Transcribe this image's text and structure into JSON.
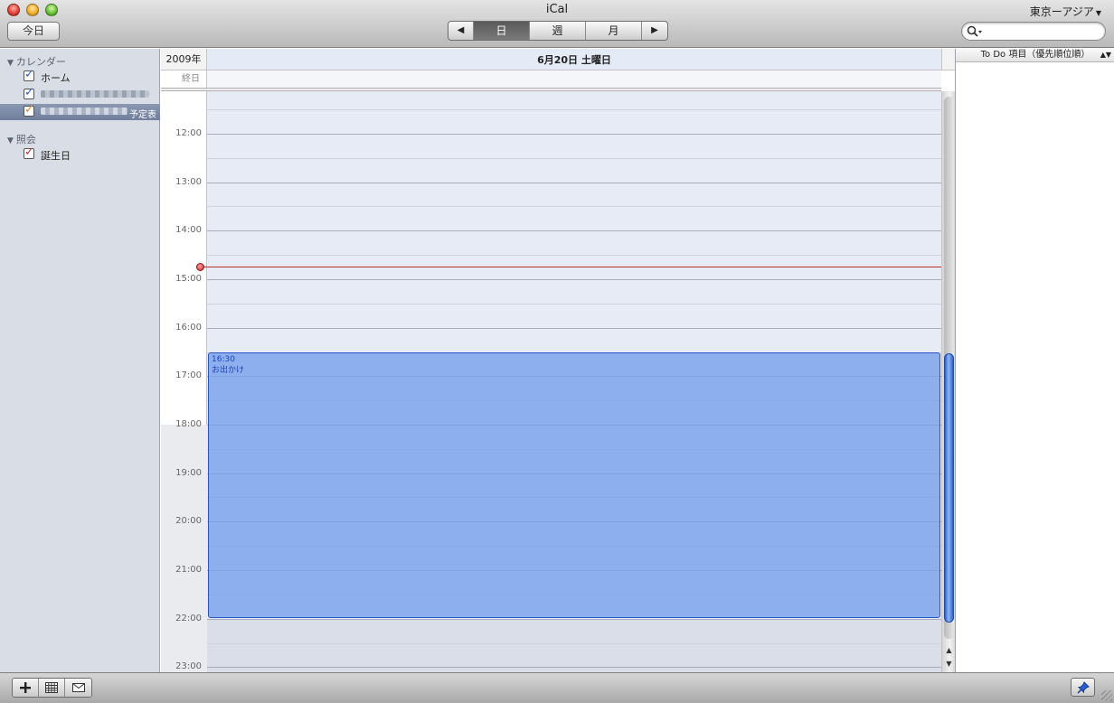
{
  "window": {
    "title": "iCal"
  },
  "toolbar": {
    "today_label": "今日",
    "prev_glyph": "◀",
    "next_glyph": "▶",
    "views": [
      "日",
      "週",
      "月"
    ],
    "selected_view": "日",
    "timezone_label": "東京ーアジア",
    "search_placeholder": ""
  },
  "sidebar": {
    "calendars_header": "カレンダー",
    "calendars": [
      {
        "label": "ホーム",
        "color": "#2f5fc9",
        "checked": true
      },
      {
        "label": "",
        "color": "#2f5fc9",
        "checked": true,
        "blurred": true
      },
      {
        "label": "予定表",
        "color": "#e8862a",
        "checked": true,
        "selected": true,
        "blurred": true
      }
    ],
    "subscriptions_header": "照会",
    "subscriptions": [
      {
        "label": "誕生日",
        "color": "#d03030",
        "checked": true
      }
    ]
  },
  "calendar": {
    "year_label": "2009年",
    "date_label": "6月20日 土曜日",
    "allday_label": "終日",
    "hours": [
      "12:00",
      "13:00",
      "14:00",
      "15:00",
      "16:00",
      "17:00",
      "18:00",
      "19:00",
      "20:00",
      "21:00",
      "22:00",
      "23:00"
    ],
    "event": {
      "time": "16:30",
      "title": "お出かけ",
      "color": "#78a0ec"
    }
  },
  "todo": {
    "header": "To Do 項目（優先順位順）"
  }
}
